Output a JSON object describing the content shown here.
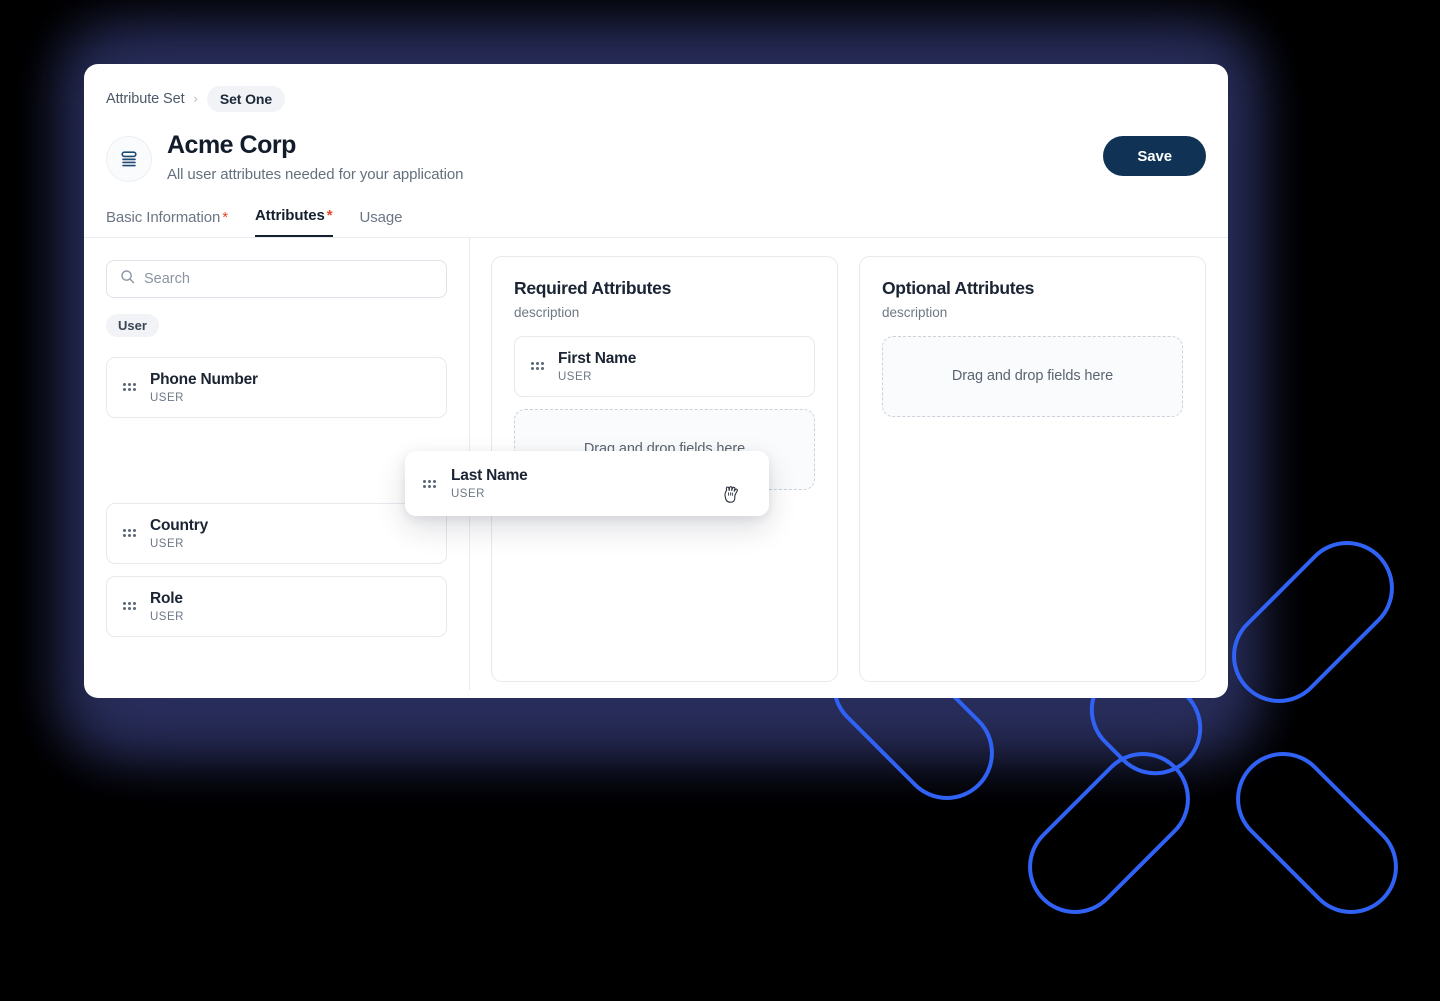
{
  "window": {
    "breadcrumb": {
      "root": "Attribute Set",
      "separator": "›",
      "current": "Set One"
    },
    "header": {
      "icon": "stack-lines-icon",
      "title": "Acme Corp",
      "subtitle": "All user attributes needed for your application",
      "save_label": "Save"
    },
    "tabs": [
      {
        "label": "Basic Information",
        "required_mark": "*",
        "active": false
      },
      {
        "label": "Attributes",
        "required_mark": "*",
        "active": true
      },
      {
        "label": "Usage",
        "required_mark": "",
        "active": false
      }
    ]
  },
  "sidebar": {
    "search": {
      "placeholder": "Search",
      "value": "",
      "icon": "search-icon"
    },
    "group_chip": "User",
    "items": [
      {
        "name": "Phone Number",
        "meta": "USER"
      },
      {
        "name": "Country",
        "meta": "USER"
      },
      {
        "name": "Role",
        "meta": "USER"
      }
    ]
  },
  "panels": [
    {
      "title": "Required Attributes",
      "description": "description",
      "items": [
        {
          "name": "First Name",
          "meta": "USER"
        }
      ],
      "dropzone_label": "Drag and drop fields here"
    },
    {
      "title": "Optional Attributes",
      "description": "description",
      "items": [],
      "dropzone_label": "Drag and drop fields here"
    }
  ],
  "drag_ghost": {
    "name": "Last Name",
    "meta": "USER",
    "cursor": "grabbing-hand-cursor"
  },
  "colors": {
    "accent_blue": "#2f62f5",
    "save_navy": "#0f3255",
    "required_red": "#e8452c",
    "glow_navy": "#242a52",
    "background": "#000000"
  }
}
